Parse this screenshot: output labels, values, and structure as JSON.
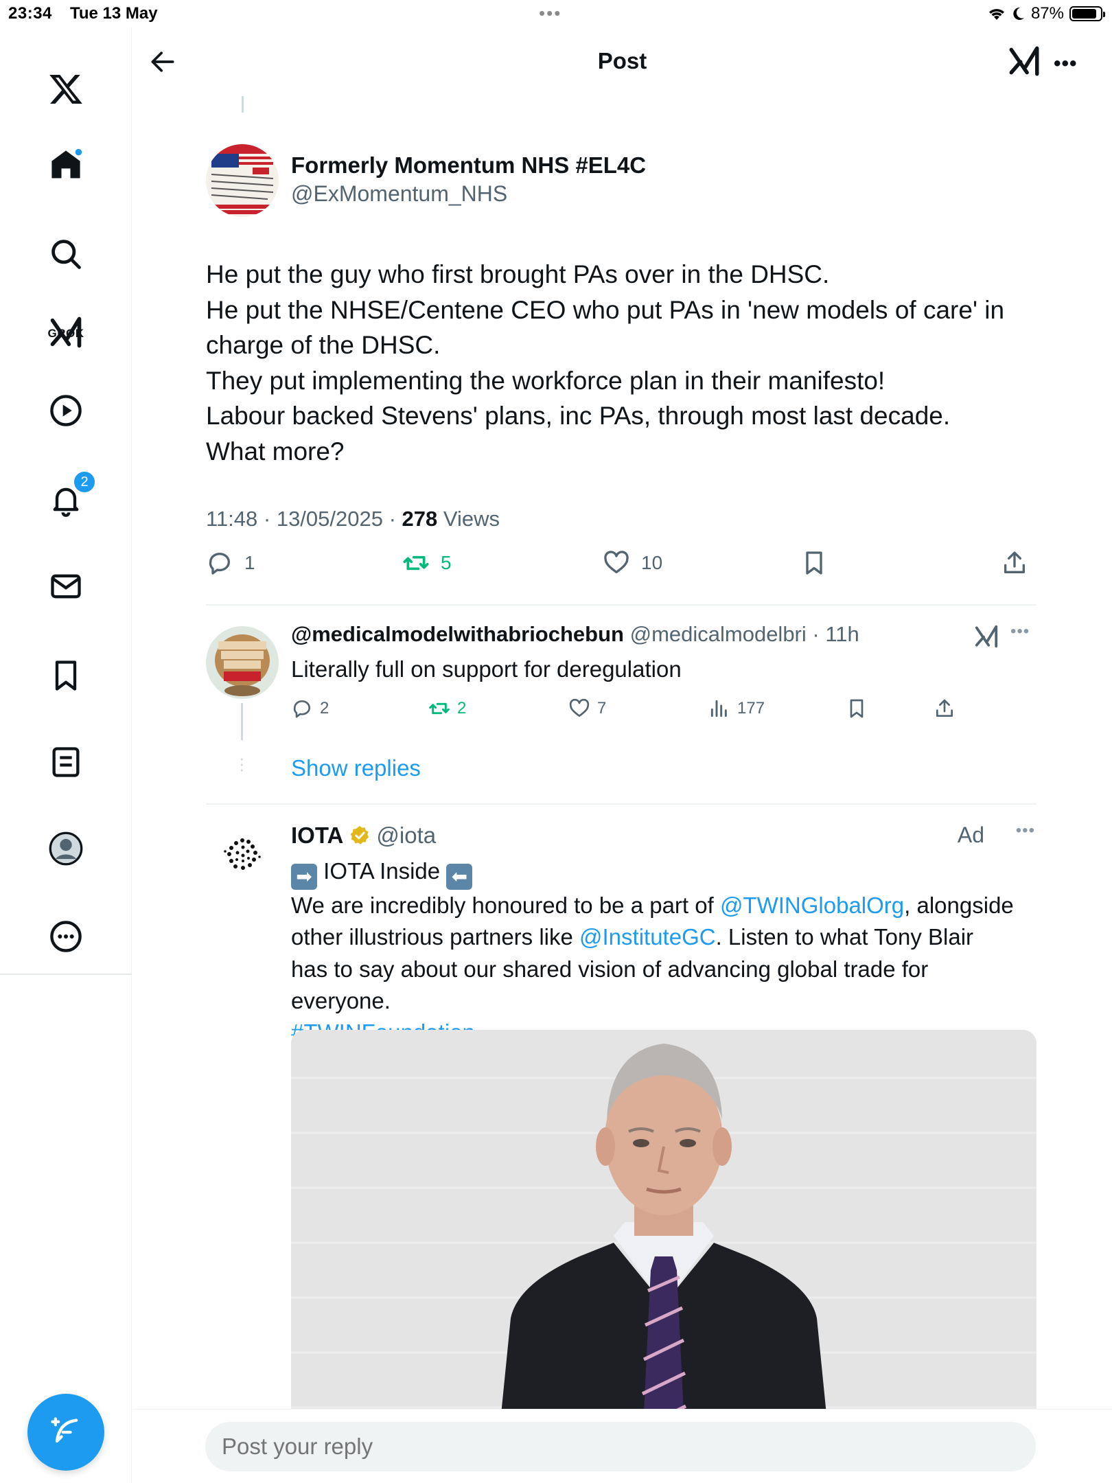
{
  "status_bar": {
    "time": "23:34",
    "date": "Tue 13 May",
    "battery": "87%",
    "battery_level": 0.87
  },
  "header": {
    "title": "Post"
  },
  "sidebar": {
    "grok_label": "GROK",
    "notifications_badge": "2"
  },
  "post": {
    "author_name": "Formerly Momentum NHS #EL4C",
    "author_handle": "@ExMomentum_NHS",
    "text_lines": [
      "He put the guy who first brought PAs over in the DHSC.",
      "He put the NHSE/Centene CEO who put PAs in 'new models of care' in",
      "charge of the DHSC.",
      "They put implementing the workforce plan in their manifesto!",
      "Labour backed Stevens' plans, inc PAs, through most last decade.",
      "What more?"
    ],
    "timestamp": "11:48 · 13/05/2025 · ",
    "views_count": "278",
    "views_label": " Views",
    "replies": "1",
    "reposts": "5",
    "likes": "10"
  },
  "reply": {
    "author_name": "@medicalmodelwithabriochebun",
    "author_handle": "@medicalmodelbri",
    "time": " · 11h",
    "text": "Literally full on support for deregulation",
    "replies": "2",
    "reposts": "2",
    "likes": "7",
    "views": "177",
    "show_replies": "Show replies"
  },
  "ad": {
    "author_name": "IOTA",
    "author_handle": "@iota",
    "ad_label": "Ad",
    "headline": "IOTA Inside",
    "line1_pre": "We are incredibly honoured to be a part of ",
    "line1_link": "@TWINGlobalOrg",
    "line1_post": ", alongside",
    "line2_pre": "other illustrious partners like ",
    "line2_link": "@InstituteGC",
    "line2_post": ". Listen to what Tony Blair",
    "line3": "has to say about our shared vision of advancing global trade for",
    "line4": "everyone.",
    "hashtag": "#TWINFoundation"
  },
  "reply_bar": {
    "placeholder": "Post your reply"
  },
  "colors": {
    "accent": "#1d9bf0",
    "repost": "#00ba7c",
    "muted": "#536471",
    "text": "#0f1419"
  }
}
